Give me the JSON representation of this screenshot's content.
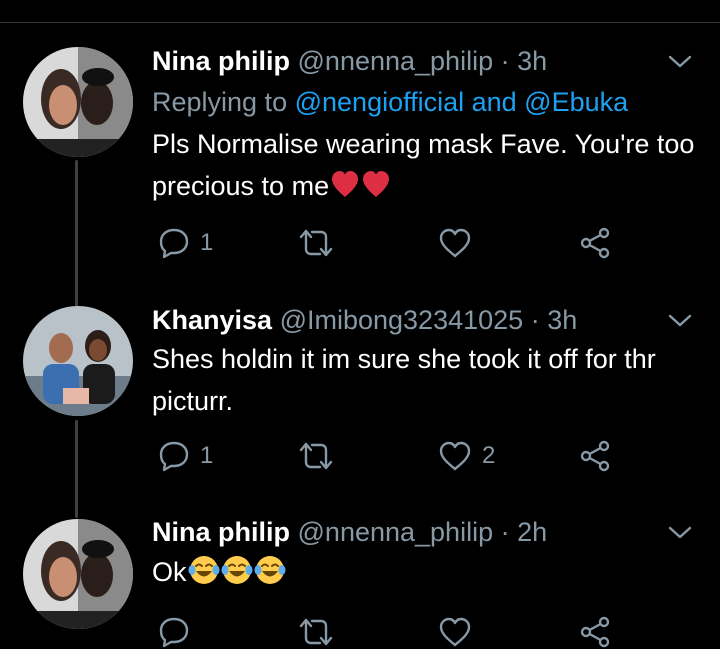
{
  "tweets": [
    {
      "name": "Nina philip",
      "handle": "@nnenna_philip",
      "separator": "·",
      "time": "3h",
      "replying_prefix": "Replying to",
      "replying_users": "@nengiofficial and @Ebuka",
      "text": "Pls Normalise wearing mask Fave. You're too precious to me",
      "emojis": [
        "red-heart",
        "red-heart"
      ],
      "reply_count": "1",
      "retweet_count": "",
      "like_count": ""
    },
    {
      "name": "Khanyisa",
      "handle": "@Imibong32341025",
      "separator": "·",
      "time": "3h",
      "text": "Shes holdin it im sure she took it off for thr picturr.",
      "reply_count": "1",
      "retweet_count": "",
      "like_count": "2"
    },
    {
      "name": "Nina philip",
      "handle": "@nnenna_philip",
      "separator": "·",
      "time": "2h",
      "text": "Ok",
      "emojis": [
        "tears-of-joy",
        "tears-of-joy",
        "tears-of-joy"
      ]
    }
  ],
  "icons": {
    "reply": "speech-bubble",
    "retweet": "retweet-arrows",
    "like": "heart-outline",
    "share": "share-nodes",
    "menu": "chevron-down"
  },
  "colors": {
    "background": "#000000",
    "muted": "#8899a6",
    "link": "#1da1f2",
    "heart": "#e0245e"
  }
}
